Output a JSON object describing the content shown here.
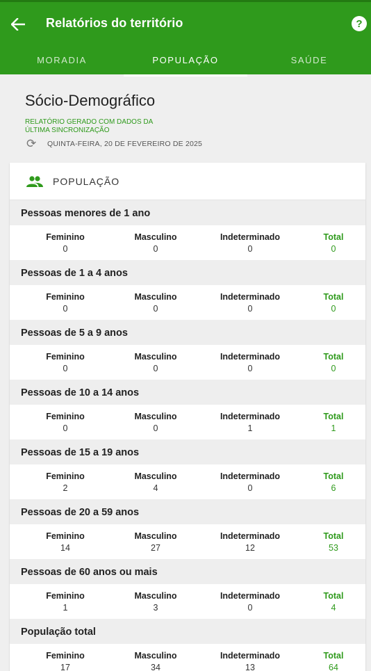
{
  "appbar": {
    "title": "Relatórios do território",
    "tabs": [
      {
        "label": "MORADIA"
      },
      {
        "label": "POPULAÇÃO"
      },
      {
        "label": "SAÚDE"
      }
    ]
  },
  "header": {
    "section_title": "Sócio-Demográfico",
    "note": "RELATÓRIO GERADO COM DADOS DA ÚLTIMA SINCRONIZAÇÃO",
    "sync_date": "QUINTA-FEIRA, 20 DE FEVEREIRO DE 2025"
  },
  "card": {
    "title": "POPULAÇÃO",
    "labels": {
      "female": "Feminino",
      "male": "Masculino",
      "undetermined": "Indeterminado",
      "total": "Total"
    },
    "groups": [
      {
        "title": "Pessoas menores de 1 ano",
        "female": "0",
        "male": "0",
        "undetermined": "0",
        "total": "0"
      },
      {
        "title": "Pessoas de 1 a 4 anos",
        "female": "0",
        "male": "0",
        "undetermined": "0",
        "total": "0"
      },
      {
        "title": "Pessoas de 5 a 9 anos",
        "female": "0",
        "male": "0",
        "undetermined": "0",
        "total": "0"
      },
      {
        "title": "Pessoas de 10 a 14 anos",
        "female": "0",
        "male": "0",
        "undetermined": "1",
        "total": "1"
      },
      {
        "title": "Pessoas de 15 a 19 anos",
        "female": "2",
        "male": "4",
        "undetermined": "0",
        "total": "6"
      },
      {
        "title": "Pessoas de 20 a 59 anos",
        "female": "14",
        "male": "27",
        "undetermined": "12",
        "total": "53"
      },
      {
        "title": "Pessoas de 60 anos ou mais",
        "female": "1",
        "male": "3",
        "undetermined": "0",
        "total": "4"
      },
      {
        "title": "População total",
        "female": "17",
        "male": "34",
        "undetermined": "13",
        "total": "64"
      }
    ]
  },
  "colors": {
    "primary": "#2f9a1c",
    "primary_dark": "#237a12",
    "background": "#efefef"
  },
  "icons": {
    "back": "arrow-left-icon",
    "help": "help-circle-icon",
    "sync": "sync-icon",
    "people": "people-icon"
  }
}
